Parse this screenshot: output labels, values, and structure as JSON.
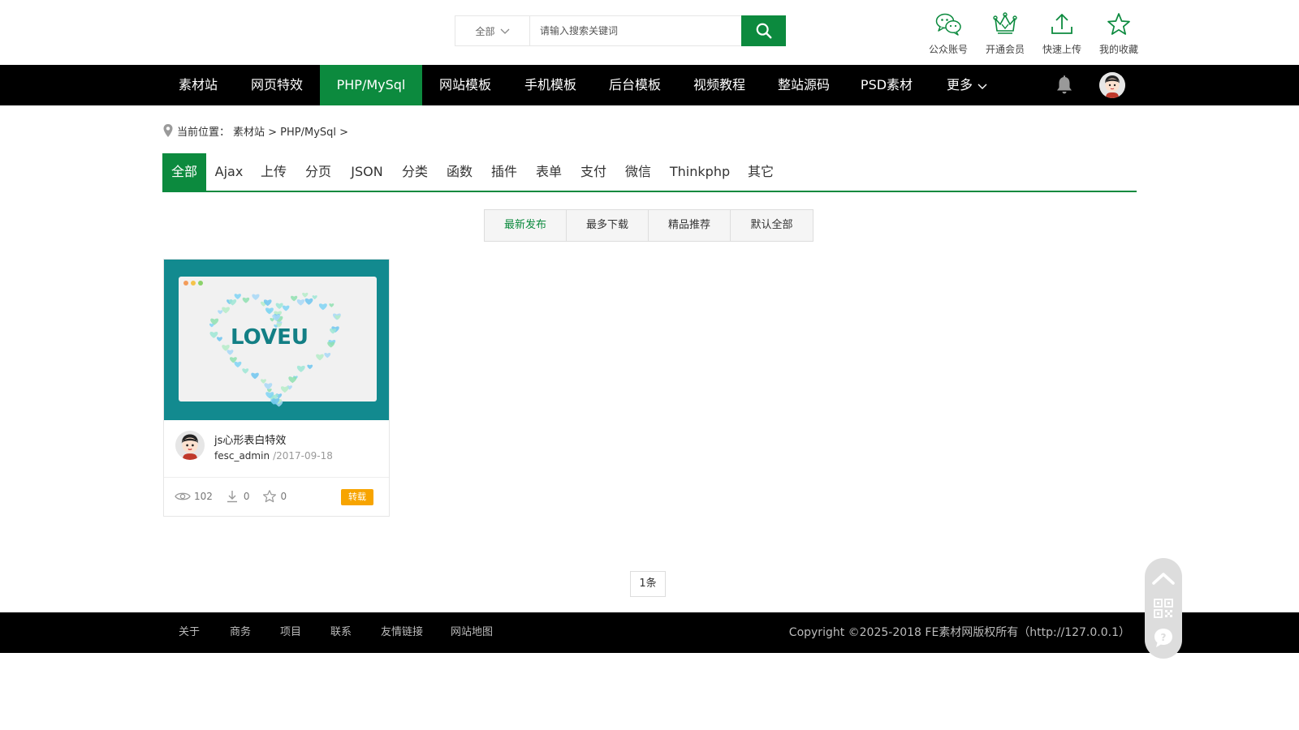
{
  "header": {
    "search": {
      "category": "全部",
      "placeholder": "请输入搜索关键词"
    },
    "quick_links": [
      {
        "label": "公众账号",
        "icon": "wechat-icon"
      },
      {
        "label": "开通会员",
        "icon": "crown-icon"
      },
      {
        "label": "快速上传",
        "icon": "upload-icon"
      },
      {
        "label": "我的收藏",
        "icon": "star-icon"
      }
    ]
  },
  "nav": {
    "items": [
      "素材站",
      "网页特效",
      "PHP/MySql",
      "网站模板",
      "手机模板",
      "后台模板",
      "视频教程",
      "整站源码",
      "PSD素材"
    ],
    "more_label": "更多",
    "active_index": 2
  },
  "breadcrumb": {
    "prefix": "当前位置：",
    "trail": "素材站 > PHP/MySql >"
  },
  "category_tabs": [
    "全部",
    "Ajax",
    "上传",
    "分页",
    "JSON",
    "分类",
    "函数",
    "插件",
    "表单",
    "支付",
    "微信",
    "Thinkphp",
    "其它"
  ],
  "sort_options": [
    "最新发布",
    "最多下载",
    "精品推荐",
    "默认全部"
  ],
  "items": [
    {
      "title": "js心形表白特效",
      "thumb_text": "LOVEU",
      "author": "fesc_admin",
      "date": "/2017-09-18",
      "views": "102",
      "downloads": "0",
      "favorites": "0",
      "badge": "转载"
    }
  ],
  "pagination": {
    "count_label": "1条"
  },
  "footer": {
    "links": [
      "关于",
      "商务",
      "项目",
      "联系",
      "友情链接",
      "网站地图"
    ],
    "copyright": "Copyright ©2025-2018 FE素材网版权所有（http://127.0.0.1）"
  },
  "colors": {
    "brand_green": "#0c8a3e",
    "nav_bg": "#000000",
    "badge": "#f7a400",
    "thumb_bg": "#128a8f"
  }
}
